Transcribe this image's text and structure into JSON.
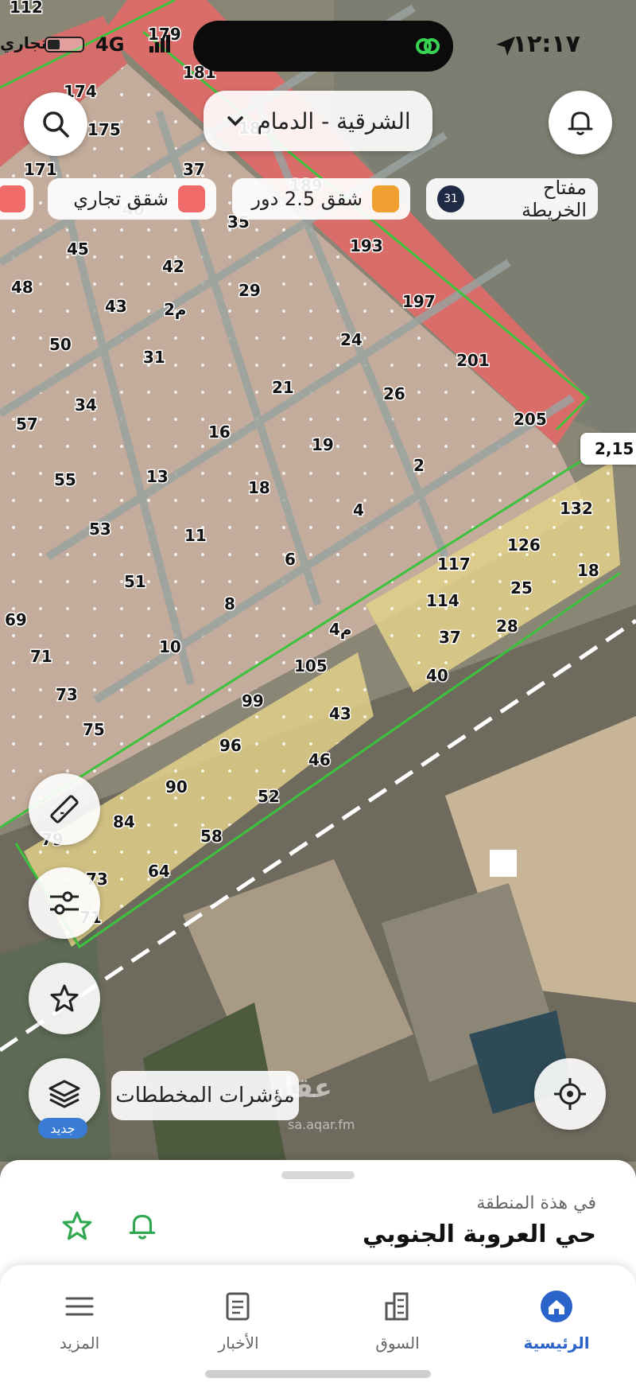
{
  "status_bar": {
    "time": "١٢:١٧",
    "network": "4G",
    "carrier_fragment": "تجاري",
    "battery_level": 0.35
  },
  "header": {
    "location_label": "الشرقية - الدمام",
    "search_icon": "search-icon",
    "bell_icon": "bell-icon",
    "dropdown_icon": "chevron-down-icon"
  },
  "legend": {
    "map_key_label": "مفتاح الخريطة",
    "map_key_count": "31",
    "chips": [
      {
        "label": "شقق 2.5 دور",
        "color": "#f0a030"
      },
      {
        "label": "شقق تجاري",
        "color": "#f06a6a"
      }
    ]
  },
  "map": {
    "price_tag": "2,15",
    "indicators_label": "مؤشرات المخططات",
    "new_badge": "جديد",
    "watermark": "عقار",
    "watermark_sub": "sa.aqar.fm",
    "plot_labels": [
      {
        "t": "112"
      },
      {
        "t": "179"
      },
      {
        "t": "181"
      },
      {
        "t": "174"
      },
      {
        "t": "175"
      },
      {
        "t": "185"
      },
      {
        "t": "171"
      },
      {
        "t": "37"
      },
      {
        "t": "189"
      },
      {
        "t": "40"
      },
      {
        "t": "35"
      },
      {
        "t": "193"
      },
      {
        "t": "45"
      },
      {
        "t": "42"
      },
      {
        "t": "48"
      },
      {
        "t": "29"
      },
      {
        "t": "197"
      },
      {
        "t": "43"
      },
      {
        "t": "م2"
      },
      {
        "t": "50"
      },
      {
        "t": "24"
      },
      {
        "t": "31"
      },
      {
        "t": "201"
      },
      {
        "t": "21"
      },
      {
        "t": "26"
      },
      {
        "t": "34"
      },
      {
        "t": "57"
      },
      {
        "t": "205"
      },
      {
        "t": "16"
      },
      {
        "t": "19"
      },
      {
        "t": "2"
      },
      {
        "t": "55"
      },
      {
        "t": "13"
      },
      {
        "t": "18"
      },
      {
        "t": "4"
      },
      {
        "t": "132"
      },
      {
        "t": "53"
      },
      {
        "t": "11"
      },
      {
        "t": "126"
      },
      {
        "t": "6"
      },
      {
        "t": "117"
      },
      {
        "t": "18"
      },
      {
        "t": "51"
      },
      {
        "t": "25"
      },
      {
        "t": "114"
      },
      {
        "t": "69"
      },
      {
        "t": "8"
      },
      {
        "t": "م4"
      },
      {
        "t": "28"
      },
      {
        "t": "37"
      },
      {
        "t": "71"
      },
      {
        "t": "10"
      },
      {
        "t": "105"
      },
      {
        "t": "40"
      },
      {
        "t": "73"
      },
      {
        "t": "99"
      },
      {
        "t": "43"
      },
      {
        "t": "75"
      },
      {
        "t": "96"
      },
      {
        "t": "46"
      },
      {
        "t": "90"
      },
      {
        "t": "52"
      },
      {
        "t": "84"
      },
      {
        "t": "58"
      },
      {
        "t": "79"
      },
      {
        "t": "64"
      },
      {
        "t": "73"
      },
      {
        "t": "71"
      }
    ]
  },
  "floating_buttons": {
    "ruler": "ruler-icon",
    "filters": "sliders-icon",
    "favorites": "star-icon",
    "layers": "layers-icon",
    "locate": "crosshair-icon"
  },
  "sheet": {
    "subtitle": "في هذة المنطقة",
    "title": "حي العروبة الجنوبي"
  },
  "tabs": [
    {
      "label": "الرئيسية",
      "icon": "home-icon",
      "active": true
    },
    {
      "label": "السوق",
      "icon": "building-icon",
      "active": false
    },
    {
      "label": "الأخبار",
      "icon": "news-icon",
      "active": false
    },
    {
      "label": "المزيد",
      "icon": "menu-icon",
      "active": false
    }
  ],
  "colors": {
    "accent": "#2a63c9",
    "commercial_plot": "#e8706e",
    "residential_plot": "#d8b8a6",
    "highlight_plot": "#e4d48a",
    "boundary": "#3cc23c"
  }
}
